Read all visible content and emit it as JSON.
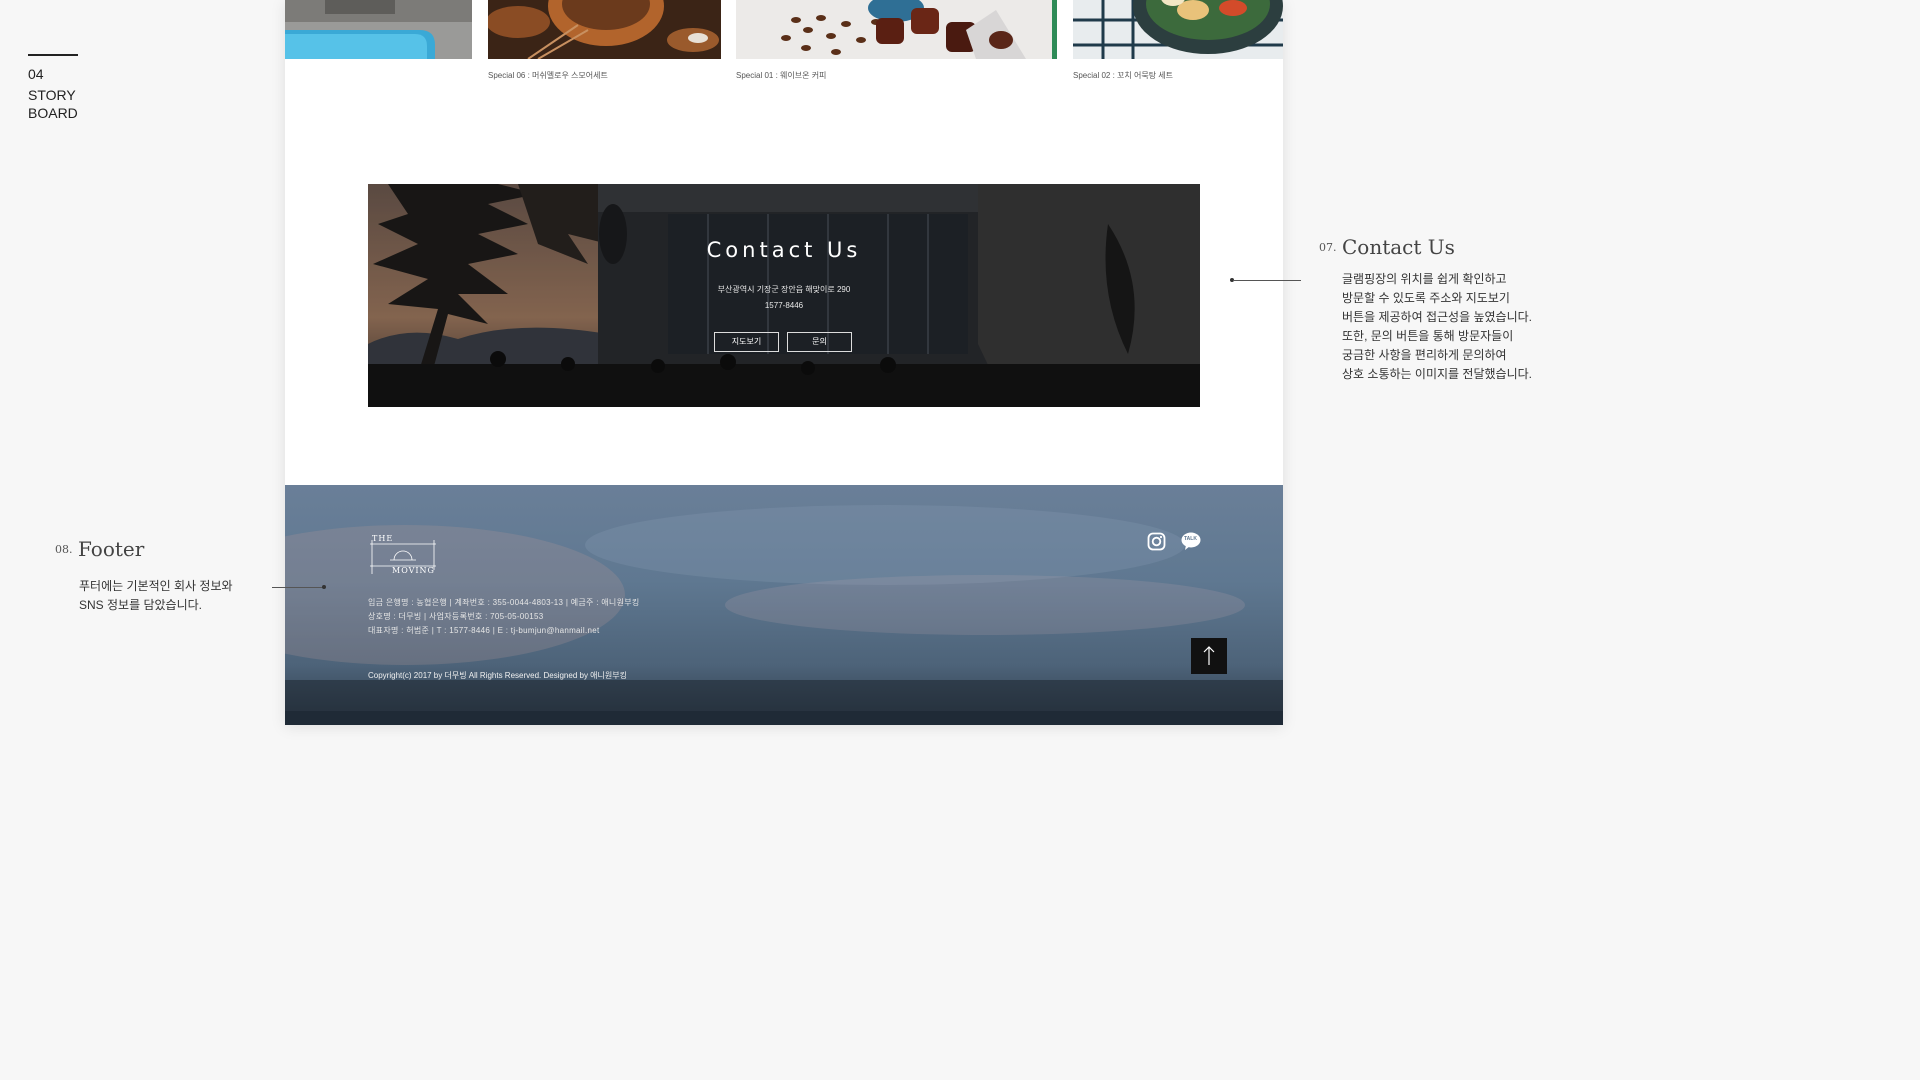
{
  "storyboard": {
    "number": "04",
    "label": "STORY BOARD"
  },
  "gallery": {
    "captions": [
      "Special 06 : 머쉬멜로우 스모어세트",
      "Special 01 : 웨이브온 커피",
      "Special 02 : 꼬치 어묵탕 세트"
    ]
  },
  "contact": {
    "title": "Contact Us",
    "address": "부산광역시 기장군 장안읍 해맞이로 290",
    "phone": "1577-8446",
    "map_button": "지도보기",
    "inquiry_button": "문의"
  },
  "footer": {
    "logo_top": "THE",
    "logo_bottom": "MOVING",
    "info_line1": "입금 은행명 : 농협은행  |  계좌번호 : 355-0044-4803-13  |  예금주 : 애니원부킹",
    "info_line2": "상호명 : 더무빙  |  사업자등록번호 : 705-05-00153",
    "info_line3": "대표자명 : 허범준  |  T : 1577-8446  |  E : tj-bumjun@hanmail.net",
    "copyright": "Copyright(c) 2017 by 더무빙 All Rights Reserved. Designed by 애니원부킹",
    "talk_label": "TALK"
  },
  "annotations": {
    "contact": {
      "number": "07.",
      "title": "Contact Us",
      "body": "글램핑장의 위치를 쉽게 확인하고\n방문할 수 있도록 주소와 지도보기\n버튼을 제공하여 접근성을 높였습니다.\n또한, 문의 버튼을 통해 방문자들이\n궁금한 사항을 편리하게 문의하여\n상호 소통하는 이미지를 전달했습니다."
    },
    "footer": {
      "number": "08.",
      "title": "Footer",
      "body": "푸터에는 기본적인 회사 정보와\nSNS 정보를 담았습니다."
    }
  },
  "colors": {
    "canvas_bg": "#ffffff",
    "page_bg": "#f7f7f7",
    "top_button": "#111111"
  },
  "icons": [
    "instagram-icon",
    "kakaotalk-icon",
    "arrow-up-icon"
  ]
}
